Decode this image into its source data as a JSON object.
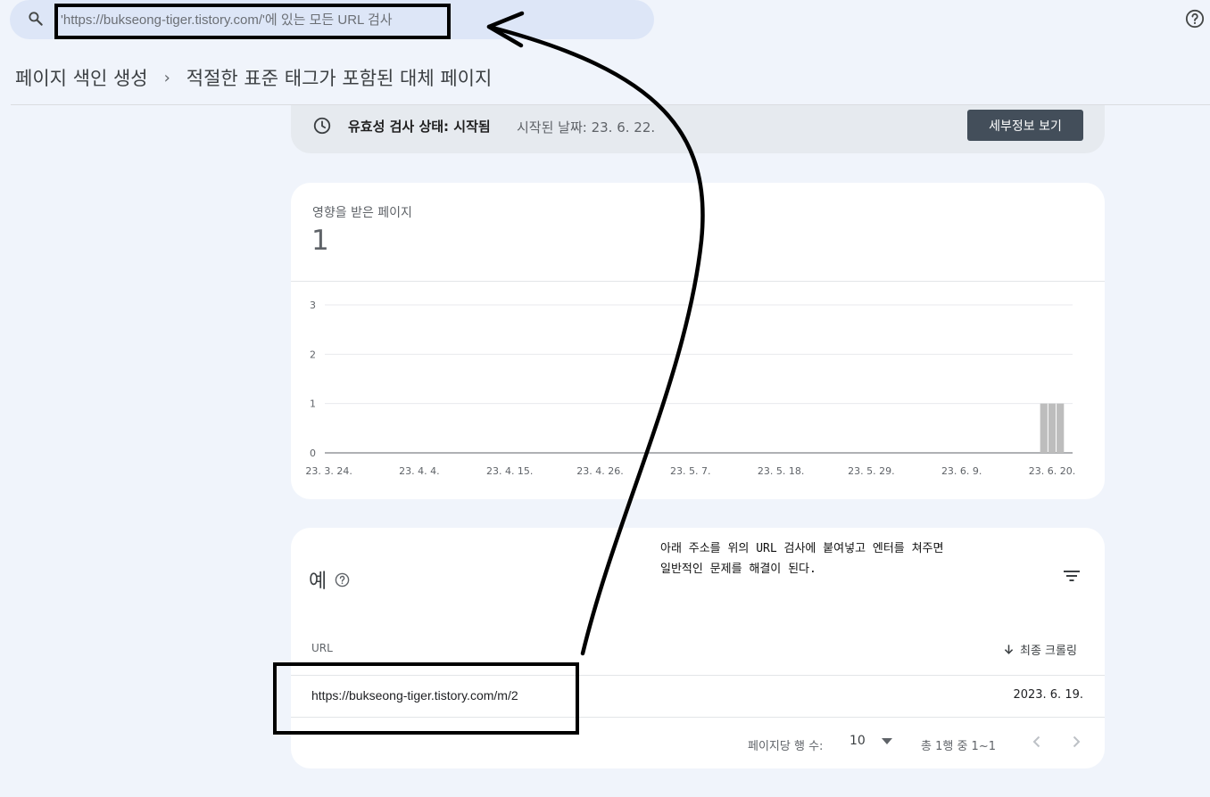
{
  "search": {
    "placeholder": "'https://bukseong-tiger.tistory.com/'에 있는 모든 URL 검사",
    "icon": "search-icon"
  },
  "help": {
    "icon": "help-icon"
  },
  "breadcrumb": {
    "parent": "페이지 색인 생성",
    "separator": "›",
    "current": "적절한 표준 태그가 포함된 대체 페이지"
  },
  "validation": {
    "icon": "clock-icon",
    "title": "유효성 검사 상태: 시작됨",
    "date": "시작된 날짜: 23. 6. 22.",
    "details_button": "세부정보 보기"
  },
  "metric": {
    "label": "영향을 받은 페이지",
    "value": "1"
  },
  "chart_data": {
    "type": "bar",
    "title": "",
    "xlabel": "",
    "ylabel": "",
    "ylim": [
      0,
      3
    ],
    "yticks": [
      "0",
      "1",
      "2",
      "3"
    ],
    "xticks": [
      "23. 3. 24.",
      "23. 4. 4.",
      "23. 4. 15.",
      "23. 4. 26.",
      "23. 5. 7.",
      "23. 5. 18.",
      "23. 5. 29.",
      "23. 6. 9.",
      "23. 6. 20."
    ],
    "x_start": "23. 3. 24.",
    "x_end": "23. 6. 22.",
    "bars": [
      {
        "x": "23. 6. 19.",
        "value": 1
      },
      {
        "x": "23. 6. 20.",
        "value": 1
      },
      {
        "x": "23. 6. 21.",
        "value": 1
      }
    ],
    "bar_color": "#bdbdbd",
    "grid": true
  },
  "examples": {
    "title": "예",
    "annotation_line1": "아래 주소를 위의 URL 검사에 붙여넣고 엔터를 쳐주면",
    "annotation_line2": "일반적인 문제를 해결이 된다.",
    "col_url": "URL",
    "col_sort": "최종 크롤링",
    "rows": [
      {
        "url": "https://bukseong-tiger.tistory.com/m/2",
        "date": "2023. 6. 19."
      }
    ]
  },
  "pagination": {
    "rows_label": "페이지당 행 수:",
    "rows_value": "10",
    "range": "총 1행 중 1~1"
  },
  "colors": {
    "background": "#f0f4fb",
    "search_bg": "#dde6f7",
    "button_bg": "#434e5a",
    "card_bg": "#ffffff"
  }
}
